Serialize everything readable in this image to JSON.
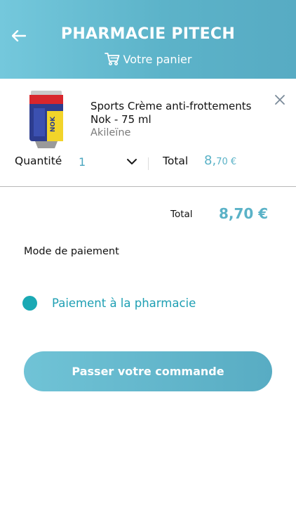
{
  "header": {
    "title": "PHARMACIE PITECH",
    "subtitle": "Votre panier",
    "back_icon": "arrow-left-icon",
    "cart_icon": "cart-icon"
  },
  "cart_item": {
    "name": "Sports Crème anti-frottements Nok - 75 ml",
    "brand": "Akileïne",
    "image_label": "NOK",
    "quantity_label": "Quantité",
    "quantity_value": "1",
    "total_label": "Total",
    "total_main": "8,",
    "total_cents": "70 €",
    "close_icon": "close-icon",
    "chevron_icon": "chevron-down-icon"
  },
  "summary": {
    "total_label": "Total",
    "total_value": "8,70 €"
  },
  "payment": {
    "title": "Mode de paiement",
    "option_label": "Paiement à la pharmacie"
  },
  "order_button": {
    "label": "Passer votre commande"
  },
  "colors": {
    "header_gradient_start": "#74c8dc",
    "header_gradient_end": "#57abc3",
    "accent": "#5ab2c7",
    "radio": "#1aa9b4"
  }
}
